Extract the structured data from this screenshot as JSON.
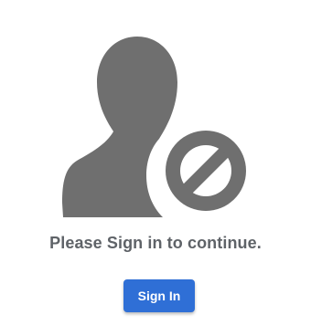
{
  "message": "Please Sign in to continue.",
  "signin_button_label": "Sign In",
  "colors": {
    "icon": "#6f6f6f",
    "message": "#5f6368",
    "button": "#2f6fd6",
    "button_text": "#ffffff",
    "background": "#ffffff"
  },
  "icons": {
    "user": "user-icon",
    "blocked": "blocked-icon"
  }
}
